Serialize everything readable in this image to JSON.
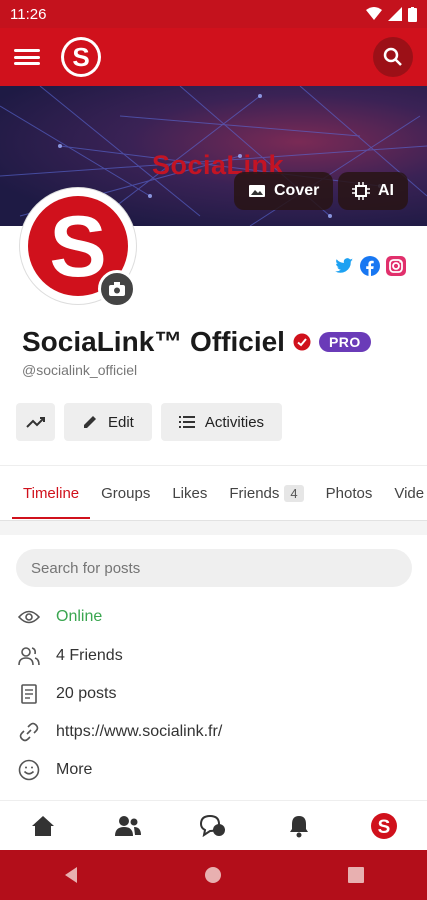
{
  "status_bar": {
    "time": "11:26"
  },
  "cover": {
    "brand_text": "SociaLink",
    "cover_button_label": "Cover",
    "ai_button_label": "AI"
  },
  "profile": {
    "name": "SociaLink™ Officiel",
    "badge": "PRO",
    "handle": "@socialink_officiel"
  },
  "actions": {
    "edit_label": "Edit",
    "activities_label": "Activities"
  },
  "tabs": [
    {
      "label": "Timeline",
      "active": true
    },
    {
      "label": "Groups"
    },
    {
      "label": "Likes"
    },
    {
      "label": "Friends",
      "count": "4"
    },
    {
      "label": "Photos"
    },
    {
      "label": "Vide"
    }
  ],
  "search": {
    "placeholder": "Search for posts"
  },
  "info": {
    "online": "Online",
    "friends": "4 Friends",
    "posts": "20 posts",
    "website": "https://www.socialink.fr/",
    "more": "More"
  },
  "colors": {
    "brand": "#d0111c",
    "pro": "#6a3bb8",
    "online": "#3aa650"
  }
}
